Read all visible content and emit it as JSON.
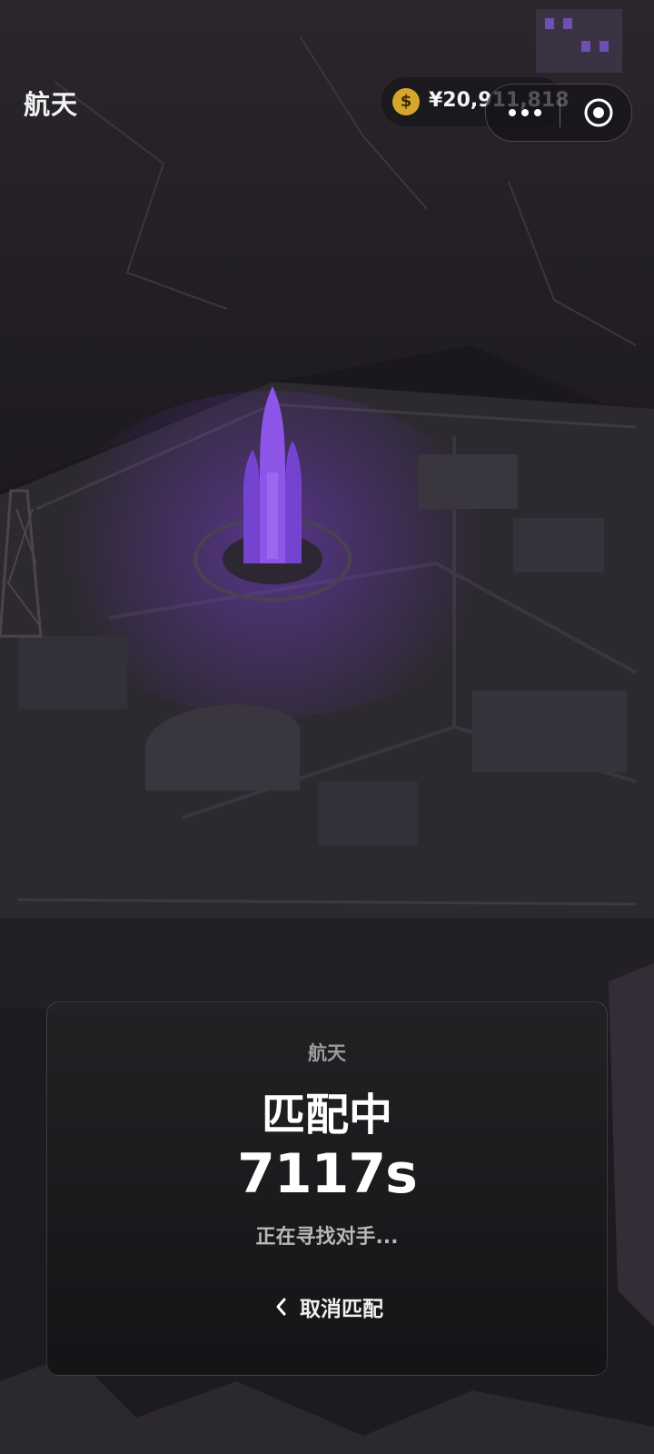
{
  "header": {
    "title": "航天",
    "coin_symbol": "$",
    "balance": "¥20,911,818"
  },
  "match_panel": {
    "mode": "航天",
    "status": "匹配中",
    "timer": "7117s",
    "subtitle": "正在寻找对手...",
    "cancel_label": "取消匹配"
  },
  "icons": {
    "coin": "dollar-coin-icon",
    "more": "more-dots-icon",
    "close": "target-circle-icon",
    "back": "chevron-left-icon"
  },
  "colors": {
    "accent": "#8a4ee6",
    "coin": "#d6a52c",
    "background": "#1a171c"
  }
}
